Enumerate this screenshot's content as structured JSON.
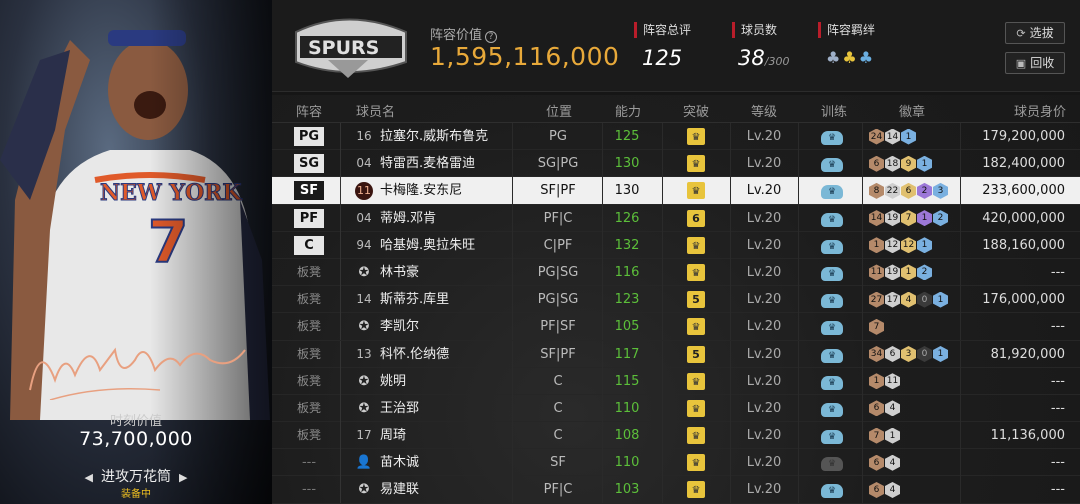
{
  "card": {
    "moment_label": "时刻价值",
    "moment_value": "73,700,000",
    "card_name": "进攻万花筒",
    "equipped": "装备中"
  },
  "header": {
    "lineup_value_label": "阵容价值",
    "lineup_value": "1,595,116,000",
    "stats": [
      {
        "label": "阵容总评",
        "value": "125"
      },
      {
        "label": "球员数",
        "value": "38",
        "max": "/300"
      },
      {
        "label": "阵容羁绊",
        "value": ""
      }
    ],
    "buttons": [
      {
        "label": "选拔",
        "icon": "refresh-icon"
      },
      {
        "label": "回收",
        "icon": "recycle-icon"
      }
    ]
  },
  "columns": [
    "阵容",
    "球员名",
    "位置",
    "能力",
    "突破",
    "等级",
    "训练",
    "徽章",
    "球员身价"
  ],
  "rows": [
    {
      "slot": "PG",
      "type": "starter",
      "num": "16",
      "name": "拉塞尔.威斯布鲁克",
      "pos": "PG",
      "ability": "125",
      "break": "crown",
      "level": "Lv.20",
      "train": "on",
      "badges": [
        [
          "b",
          "24"
        ],
        [
          "s",
          "14"
        ],
        [
          "bl",
          "1"
        ]
      ],
      "worth": "179,200,000"
    },
    {
      "slot": "SG",
      "type": "starter",
      "num": "04",
      "name": "特雷西.麦格雷迪",
      "pos": "SG|PG",
      "ability": "130",
      "break": "crown",
      "level": "Lv.20",
      "train": "on",
      "badges": [
        [
          "b",
          "6"
        ],
        [
          "s",
          "18"
        ],
        [
          "g",
          "9"
        ],
        [
          "bl",
          "1"
        ]
      ],
      "worth": "182,400,000"
    },
    {
      "slot": "SF",
      "type": "starter",
      "num": "11",
      "name": "卡梅隆.安东尼",
      "pos": "SF|PF",
      "ability": "130",
      "break": "crown",
      "level": "Lv.20",
      "train": "on",
      "badges": [
        [
          "b",
          "8"
        ],
        [
          "s",
          "22"
        ],
        [
          "g",
          "6"
        ],
        [
          "p",
          "2"
        ],
        [
          "bl",
          "3"
        ]
      ],
      "worth": "233,600,000",
      "selected": true
    },
    {
      "slot": "PF",
      "type": "starter",
      "num": "04",
      "name": "蒂姆.邓肯",
      "pos": "PF|C",
      "ability": "126",
      "break": "6",
      "level": "Lv.20",
      "train": "on",
      "badges": [
        [
          "b",
          "14"
        ],
        [
          "s",
          "19"
        ],
        [
          "g",
          "7"
        ],
        [
          "p",
          "1"
        ],
        [
          "bl",
          "2"
        ]
      ],
      "worth": "420,000,000"
    },
    {
      "slot": "C",
      "type": "starter",
      "num": "94",
      "name": "哈基姆.奥拉朱旺",
      "pos": "C|PF",
      "ability": "132",
      "break": "crown",
      "level": "Lv.20",
      "train": "on",
      "badges": [
        [
          "b",
          "1"
        ],
        [
          "s",
          "12"
        ],
        [
          "g",
          "12"
        ],
        [
          "bl",
          "1"
        ]
      ],
      "worth": "188,160,000"
    },
    {
      "slot": "板凳",
      "type": "bench",
      "num": "",
      "name": "林书豪",
      "pos": "PG|SG",
      "ability": "116",
      "break": "crown",
      "level": "Lv.20",
      "train": "on",
      "badges": [
        [
          "b",
          "11"
        ],
        [
          "s",
          "19"
        ],
        [
          "g",
          "1"
        ],
        [
          "bl",
          "2"
        ]
      ],
      "worth": "---"
    },
    {
      "slot": "板凳",
      "type": "bench",
      "num": "14",
      "name": "斯蒂芬.库里",
      "pos": "PG|SG",
      "ability": "123",
      "break": "5",
      "level": "Lv.20",
      "train": "on",
      "badges": [
        [
          "b",
          "27"
        ],
        [
          "s",
          "17"
        ],
        [
          "g",
          "4"
        ],
        [
          "d",
          "0"
        ],
        [
          "bl",
          "1"
        ]
      ],
      "worth": "176,000,000"
    },
    {
      "slot": "板凳",
      "type": "bench",
      "num": "",
      "name": "李凯尔",
      "pos": "PF|SF",
      "ability": "105",
      "break": "crown",
      "level": "Lv.20",
      "train": "on",
      "badges": [
        [
          "b",
          "7"
        ]
      ],
      "worth": "---"
    },
    {
      "slot": "板凳",
      "type": "bench",
      "num": "13",
      "name": "科怀.伦纳德",
      "pos": "SF|PF",
      "ability": "117",
      "break": "5",
      "level": "Lv.20",
      "train": "on",
      "badges": [
        [
          "b",
          "34"
        ],
        [
          "s",
          "6"
        ],
        [
          "g",
          "3"
        ],
        [
          "d",
          "0"
        ],
        [
          "bl",
          "1"
        ]
      ],
      "worth": "81,920,000"
    },
    {
      "slot": "板凳",
      "type": "bench",
      "num": "",
      "name": "姚明",
      "pos": "C",
      "ability": "115",
      "break": "crown",
      "level": "Lv.20",
      "train": "on",
      "badges": [
        [
          "b",
          "1"
        ],
        [
          "s",
          "11"
        ]
      ],
      "worth": "---"
    },
    {
      "slot": "板凳",
      "type": "bench",
      "num": "",
      "name": "王治郅",
      "pos": "C",
      "ability": "110",
      "break": "crown",
      "level": "Lv.20",
      "train": "on",
      "badges": [
        [
          "b",
          "6"
        ],
        [
          "s",
          "4"
        ]
      ],
      "worth": "---"
    },
    {
      "slot": "板凳",
      "type": "bench",
      "num": "17",
      "name": "周琦",
      "pos": "C",
      "ability": "108",
      "break": "crown",
      "level": "Lv.20",
      "train": "on",
      "badges": [
        [
          "b",
          "7"
        ],
        [
          "s",
          "1"
        ]
      ],
      "worth": "11,136,000"
    },
    {
      "slot": "---",
      "type": "none",
      "num": "",
      "name": "苗木诚",
      "pos": "SF",
      "ability": "110",
      "break": "crown",
      "level": "Lv.20",
      "train": "off",
      "badges": [
        [
          "b",
          "6"
        ],
        [
          "s",
          "4"
        ]
      ],
      "worth": "---"
    },
    {
      "slot": "---",
      "type": "none",
      "num": "",
      "name": "易建联",
      "pos": "PF|C",
      "ability": "103",
      "break": "crown",
      "level": "Lv.20",
      "train": "on",
      "badges": [
        [
          "b",
          "6"
        ],
        [
          "s",
          "4"
        ]
      ],
      "worth": "---"
    }
  ]
}
